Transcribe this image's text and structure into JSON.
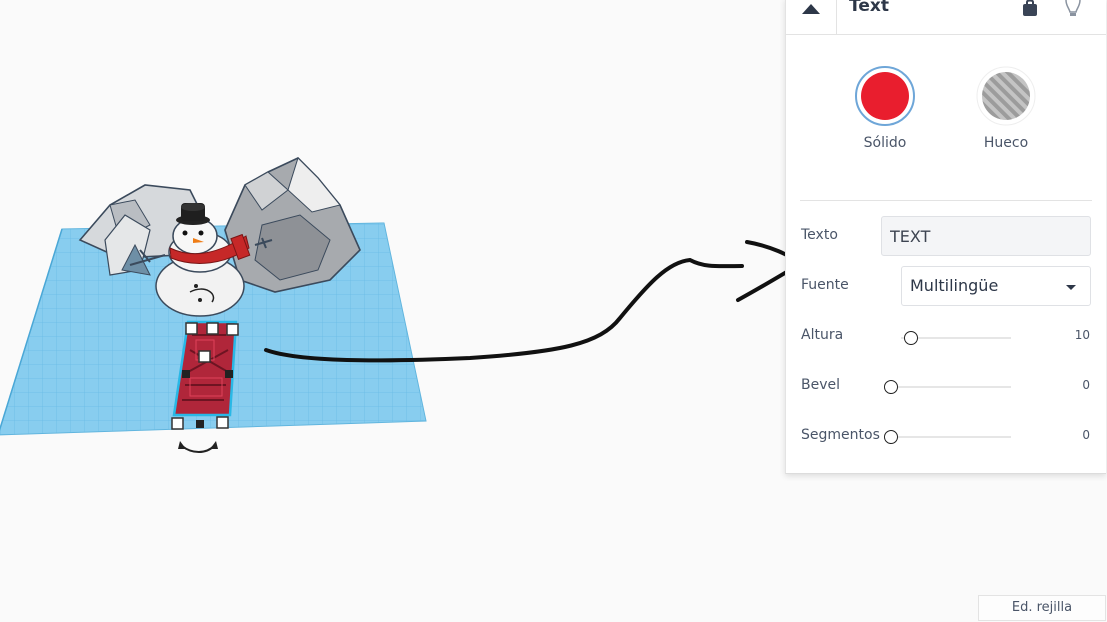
{
  "panel": {
    "title": "Text",
    "solid_label": "Sólido",
    "hole_label": "Hueco",
    "texto_label": "Texto",
    "texto_value": "TEXT",
    "fuente_label": "Fuente",
    "fuente_value": "Multilingüe",
    "altura_label": "Altura",
    "altura_value": "10",
    "altura_fraction": 0.09,
    "bevel_label": "Bevel",
    "bevel_value": "0",
    "bevel_fraction": 0.0,
    "segmentos_label": "Segmentos",
    "segmentos_value": "0",
    "segmentos_fraction": 0.0
  },
  "grid_button_label": "Ed. rejilla",
  "colors": {
    "solid_red": "#e91e2e",
    "workplane_blue": "#8fd1f0",
    "selection_cyan": "#29b8e6"
  },
  "icons": [
    "collapse-triangle-icon",
    "lock-icon",
    "lightbulb-icon",
    "rotate-arrow-icon"
  ]
}
